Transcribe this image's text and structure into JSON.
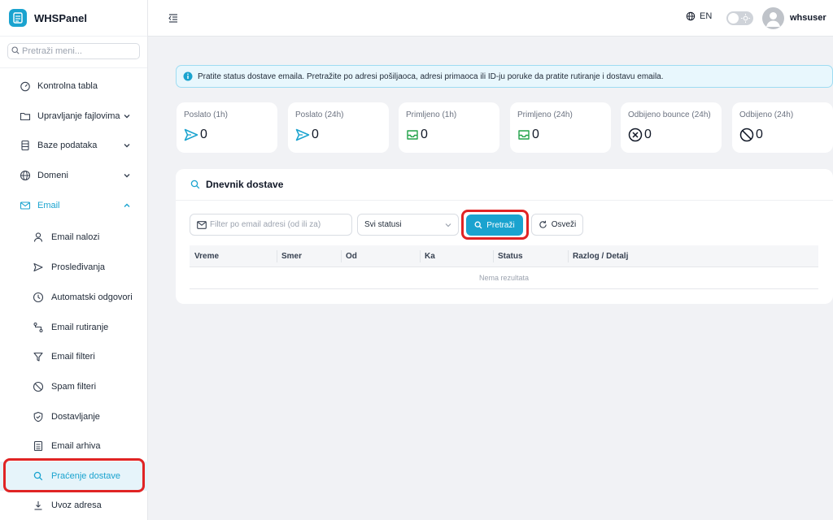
{
  "app": {
    "name": "WHSPanel"
  },
  "sidebar": {
    "search_placeholder": "Pretraži meni...",
    "items": [
      {
        "label": "Kontrolna tabla",
        "icon": "dashboard-icon"
      },
      {
        "label": "Upravljanje fajlovima",
        "icon": "folder-icon",
        "expandable": true
      },
      {
        "label": "Baze podataka",
        "icon": "database-icon",
        "expandable": true
      },
      {
        "label": "Domeni",
        "icon": "globe-icon",
        "expandable": true
      },
      {
        "label": "Email",
        "icon": "mail-icon",
        "expanded": true
      }
    ],
    "email_sub": [
      {
        "label": "Email nalozi",
        "icon": "user-icon"
      },
      {
        "label": "Prosleđivanja",
        "icon": "send-icon"
      },
      {
        "label": "Automatski odgovori",
        "icon": "clock-icon"
      },
      {
        "label": "Email rutiranje",
        "icon": "route-icon"
      },
      {
        "label": "Email filteri",
        "icon": "filter-icon"
      },
      {
        "label": "Spam filteri",
        "icon": "block-icon"
      },
      {
        "label": "Dostavljanje",
        "icon": "shield-icon"
      },
      {
        "label": "Email arhiva",
        "icon": "archive-icon"
      },
      {
        "label": "Praćenje dostave",
        "icon": "search-icon",
        "active": true
      },
      {
        "label": "Uvoz adresa",
        "icon": "import-icon"
      }
    ]
  },
  "topbar": {
    "language": "EN",
    "username": "whsuser"
  },
  "banner": {
    "text": "Pratite status dostave emaila. Pretražite po adresi pošiljaoca, adresi primaoca ili ID-ju poruke da pratite rutiranje i dostavu emaila."
  },
  "stats": [
    {
      "title": "Poslato (1h)",
      "value": "0",
      "icon": "send-icon"
    },
    {
      "title": "Poslato (24h)",
      "value": "0",
      "icon": "send-icon"
    },
    {
      "title": "Primljeno (1h)",
      "value": "0",
      "icon": "inbox-icon"
    },
    {
      "title": "Primljeno (24h)",
      "value": "0",
      "icon": "inbox-icon"
    },
    {
      "title": "Odbijeno bounce (24h)",
      "value": "0",
      "icon": "x-circle-icon"
    },
    {
      "title": "Odbijeno (24h)",
      "value": "0",
      "icon": "ban-icon"
    }
  ],
  "log": {
    "title": "Dnevnik dostave",
    "filter_placeholder": "Filter po email adresi (od ili za)",
    "status_selected": "Svi statusi",
    "search_label": "Pretraži",
    "refresh_label": "Osveži",
    "columns": [
      "Vreme",
      "Smer",
      "Od",
      "Ka",
      "Status",
      "Razlog / Detalj"
    ],
    "empty_text": "Nema rezultata"
  },
  "colors": {
    "accent": "#1aa3cf",
    "highlight": "#e02424",
    "inbox": "#22a34a"
  }
}
